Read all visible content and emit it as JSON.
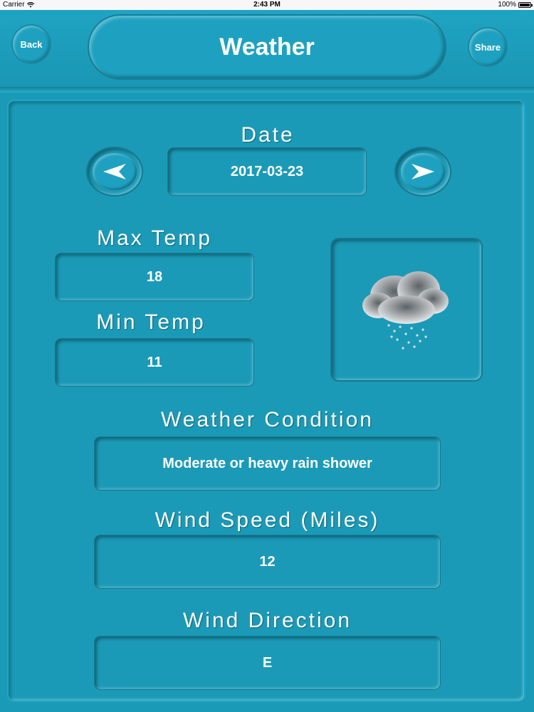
{
  "status_bar": {
    "carrier": "Carrier",
    "time": "2:43 PM",
    "battery": "100%",
    "wifi_icon": "wifi-icon",
    "battery_icon": "battery-icon"
  },
  "header": {
    "title": "Weather",
    "back_label": "Back",
    "share_label": "Share"
  },
  "date": {
    "label": "Date",
    "value": "2017-03-23",
    "prev_icon": "arrow-left-icon",
    "next_icon": "arrow-right-icon"
  },
  "max_temp": {
    "label": "Max Temp",
    "value": "18"
  },
  "min_temp": {
    "label": "Min Temp",
    "value": "11"
  },
  "weather_icon": "rain-cloud-icon",
  "condition": {
    "label": "Weather Condition",
    "value": "Moderate or heavy rain shower"
  },
  "wind_speed": {
    "label": "Wind Speed (Miles)",
    "value": "12"
  },
  "wind_direction": {
    "label": "Wind Direction",
    "value": "E"
  },
  "colors": {
    "background": "#1b9ab7",
    "status_bar": "#f7f7f7",
    "text": "#ffffff"
  }
}
